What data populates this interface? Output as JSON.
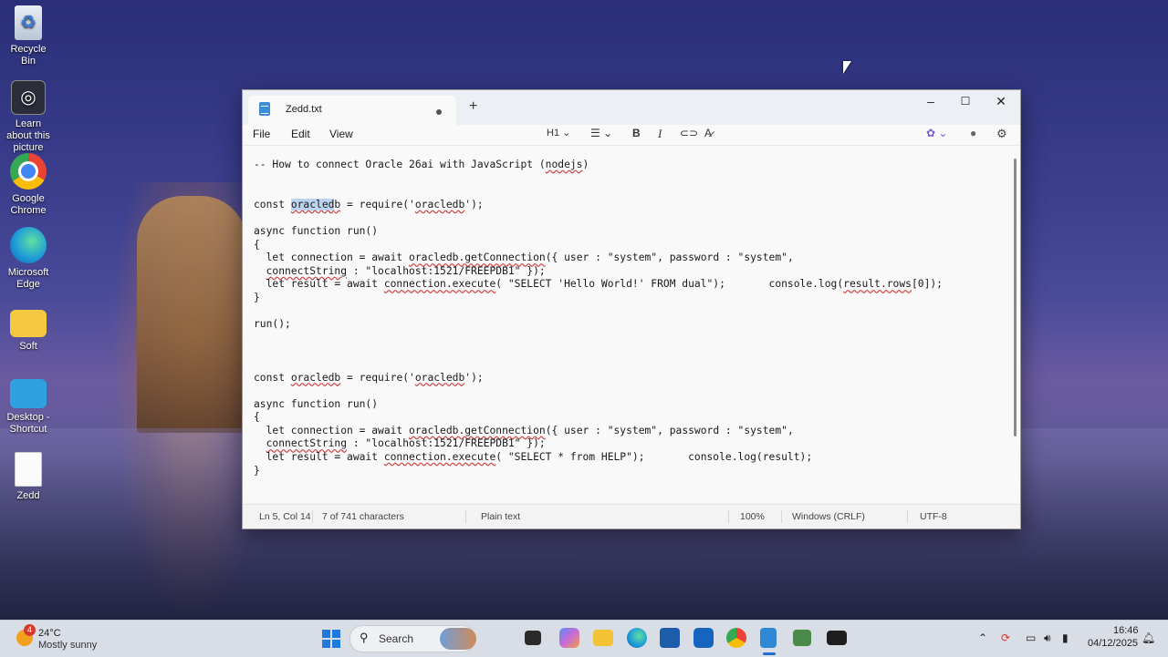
{
  "desktop": {
    "icons": [
      {
        "label": "Recycle Bin"
      },
      {
        "label": "Learn about this picture"
      },
      {
        "label": "Google Chrome"
      },
      {
        "label": "Microsoft Edge"
      },
      {
        "label": "Soft"
      },
      {
        "label": "Desktop - Shortcut"
      },
      {
        "label": "Zedd"
      }
    ]
  },
  "window": {
    "tab_title": "Zedd.txt",
    "new_tab": "+",
    "controls": {
      "minimize": "–",
      "maximize": "☐",
      "close": "✕"
    },
    "menu": {
      "file": "File",
      "edit": "Edit",
      "view": "View"
    },
    "toolbar": {
      "heading": "H1",
      "bold": "B",
      "italic": "I",
      "chevron": "⌄"
    }
  },
  "editor": {
    "lines": [
      "-- How to connect Oracle 26ai with JavaScript (nodejs)",
      "",
      "",
      "const oracledb = require('oracledb');",
      "",
      "async function run()",
      "{",
      "  let connection = await oracledb.getConnection({ user : \"system\", password : \"system\",",
      "  connectString : \"localhost:1521/FREEPDB1\" });",
      "  let result = await connection.execute( \"SELECT 'Hello World!' FROM dual\");       console.log(result.rows[0]);",
      "}",
      "",
      "run();",
      "",
      "",
      "",
      "const oracledb = require('oracledb');",
      "",
      "async function run()",
      "{",
      "  let connection = await oracledb.getConnection({ user : \"system\", password : \"system\",",
      "  connectString : \"localhost:1521/FREEPDB1\" });",
      "  let result = await connection.execute( \"SELECT * from HELP\");       console.log(result);",
      "}"
    ]
  },
  "status": {
    "position": "Ln 5, Col 14",
    "characters": "7 of 741 characters",
    "format": "Plain text",
    "zoom": "100%",
    "line_ending": "Windows (CRLF)",
    "encoding": "UTF-8"
  },
  "taskbar": {
    "weather_temp": "24°C",
    "weather_desc": "Mostly sunny",
    "weather_badge": "4",
    "search_label": "Search",
    "time": "16:46",
    "date": "04/12/2025"
  }
}
